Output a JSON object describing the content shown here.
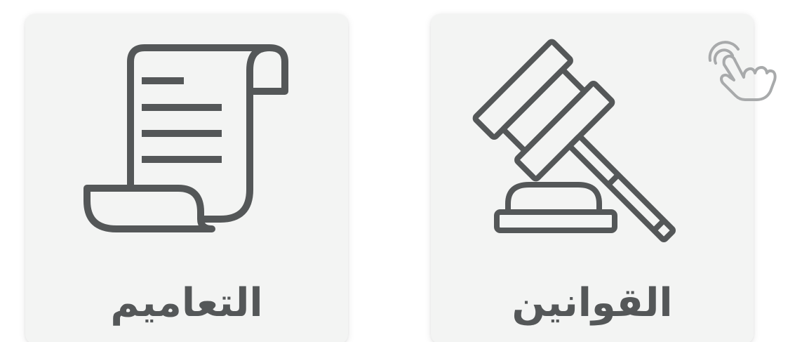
{
  "cards": [
    {
      "label": "التعاميم",
      "icon": "scroll-document-icon"
    },
    {
      "label": "القوانين",
      "icon": "gavel-icon"
    }
  ],
  "hint_icon": "tap-gesture-icon",
  "colors": {
    "card_background": "#f3f4f3",
    "icon_stroke": "#545758",
    "label_text": "#545758",
    "hint_icon_stroke": "#a8aaab"
  }
}
